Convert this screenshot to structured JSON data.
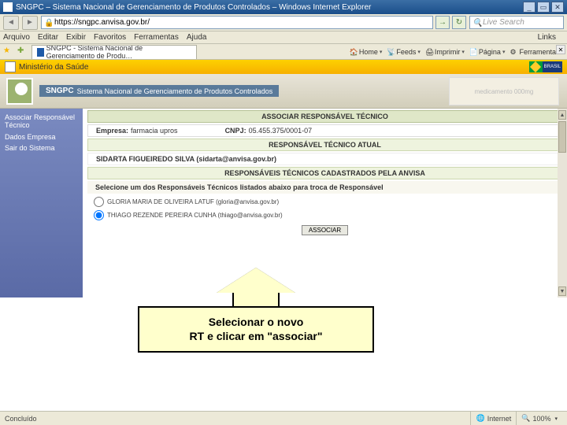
{
  "window": {
    "title": "SNGPC – Sistema Nacional de Gerenciamento de Produtos Controlados – Windows Internet Explorer",
    "min": "_",
    "max": "▭",
    "close": "✕"
  },
  "menubar": {
    "items": [
      "Arquivo",
      "Editar",
      "Exibir",
      "Favoritos",
      "Ferramentas",
      "Ajuda"
    ],
    "links": "Links"
  },
  "address": {
    "url": "https://sngpc.anvisa.gov.br/",
    "search_placeholder": "Live Search",
    "go": "→",
    "refresh": "↻"
  },
  "tab": {
    "label": "SNGPC - Sistema Nacional de Gerenciamento de Produ…"
  },
  "cmdbar": {
    "home": "Home",
    "feeds": "Feeds",
    "print": "Imprimir",
    "page": "Página",
    "tools": "Ferramentas"
  },
  "gov": {
    "ministry": "Ministério da Saúde",
    "brasil": "BRASIL"
  },
  "banner": {
    "acronym": "SNGPC",
    "full": "Sistema Nacional de Gerenciamento de Produtos Controlados",
    "pkg": "medicamento 000mg"
  },
  "sidebar": {
    "items": [
      {
        "label": "Associar Responsável Técnico"
      },
      {
        "label": "Dados Empresa"
      },
      {
        "label": "Sair do Sistema"
      }
    ]
  },
  "page": {
    "header": "ASSOCIAR RESPONSÁVEL TÉCNICO",
    "empresa_label": "Empresa:",
    "empresa_value": "farmacia upros",
    "cnpj_label": "CNPJ:",
    "cnpj_value": "05.455.375/0001-07",
    "rt_atual_header": "RESPONSÁVEL TÉCNICO ATUAL",
    "rt_atual_value": "SIDARTA FIGUEIREDO SILVA (sidarta@anvisa.gov.br)",
    "rt_cad_header": "RESPONSÁVEIS TÉCNICOS CADASTRADOS PELA ANVISA",
    "instruction": "Selecione um dos Responsáveis Técnicos listados abaixo para troca de Responsável",
    "options": [
      {
        "label": "GLORIA MARIA DE OLIVEIRA LATUF (gloria@anvisa.gov.br)",
        "checked": false
      },
      {
        "label": "THIAGO REZENDE PEREIRA CUNHA (thiago@anvisa.gov.br)",
        "checked": true
      }
    ],
    "assoc_btn": "ASSOCIAR"
  },
  "callout": {
    "line1": "Selecionar o novo",
    "line2": "RT e clicar em  \"associar\""
  },
  "status": {
    "left": "Concluído",
    "zone": "Internet",
    "zoom": "100%"
  }
}
